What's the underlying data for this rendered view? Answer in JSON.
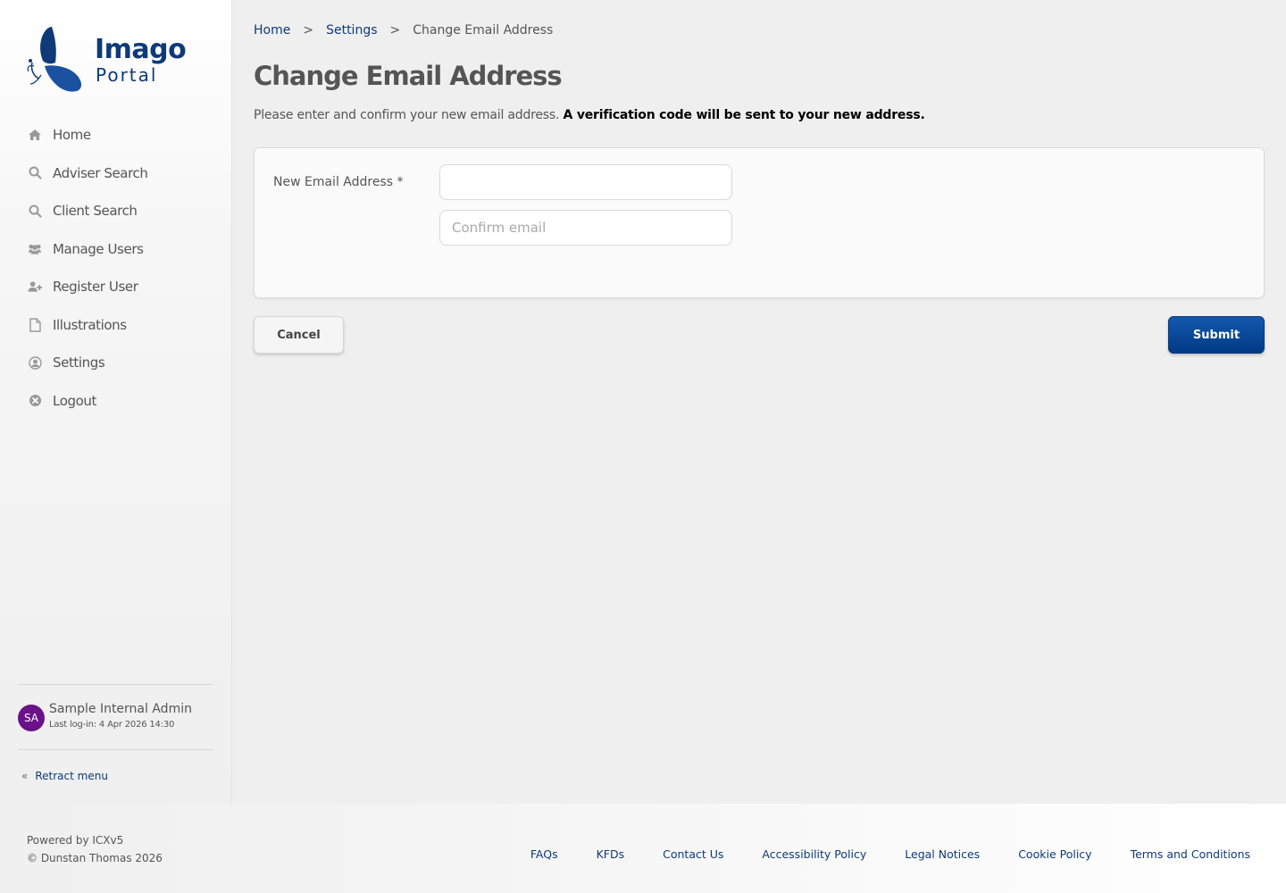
{
  "brand": {
    "name_line1": "Imago",
    "name_line2": "Portal",
    "primary_color": "#0e3a78"
  },
  "sidebar": {
    "items": [
      {
        "label": "Home",
        "icon": "home-icon"
      },
      {
        "label": "Adviser Search",
        "icon": "search-icon"
      },
      {
        "label": "Client Search",
        "icon": "search-icon"
      },
      {
        "label": "Manage Users",
        "icon": "users-icon"
      },
      {
        "label": "Register User",
        "icon": "user-plus-icon"
      },
      {
        "label": "Illustrations",
        "icon": "document-icon"
      },
      {
        "label": "Settings",
        "icon": "user-circle-icon"
      },
      {
        "label": "Logout",
        "icon": "close-circle-icon"
      }
    ],
    "user": {
      "initials": "SA",
      "name": "Sample Internal Admin",
      "last_login": "Last log-in: 4 Apr 2026 14:30",
      "avatar_color": "#6a1288"
    },
    "retract_label": "Retract menu"
  },
  "breadcrumb": {
    "items": [
      "Home",
      "Settings"
    ],
    "separator": ">",
    "current": "Change Email Address"
  },
  "page": {
    "title": "Change Email Address",
    "intro_text": "Please enter and confirm your new email address.",
    "intro_bold": "A verification code will be sent to your new address."
  },
  "form": {
    "email_label": "New Email Address *",
    "email_value": "",
    "confirm_placeholder": "Confirm email"
  },
  "actions": {
    "cancel_label": "Cancel",
    "submit_label": "Submit"
  },
  "footer": {
    "powered_by": "Powered by ICXv5",
    "copyright": "© Dunstan Thomas 2026",
    "links": [
      "FAQs",
      "KFDs",
      "Contact Us",
      "Accessibility Policy",
      "Legal Notices",
      "Cookie Policy",
      "Terms and Conditions"
    ]
  }
}
